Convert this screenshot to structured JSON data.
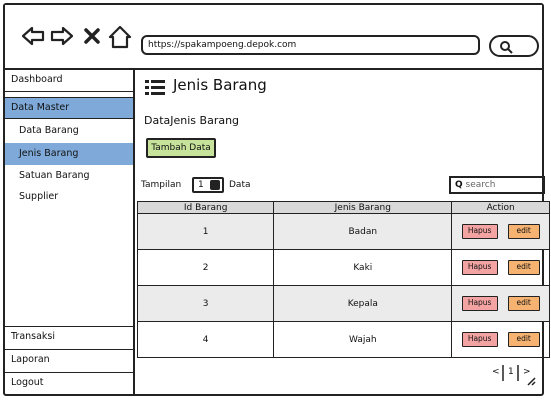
{
  "browser": {
    "url": "https://spakampoeng.depok.com"
  },
  "sidebar": {
    "items": [
      {
        "label": "Dashboard"
      },
      {
        "label": "Data Master"
      },
      {
        "label": "Data Barang"
      },
      {
        "label": "Jenis Barang"
      },
      {
        "label": "Satuan Barang"
      },
      {
        "label": "Supplier"
      },
      {
        "label": "Transaksi"
      },
      {
        "label": "Laporan"
      },
      {
        "label": "Logout"
      }
    ],
    "active": "Data Master",
    "active_sub": "Jenis Barang"
  },
  "main": {
    "title": "Jenis Barang",
    "subtitle": "DataJenis Barang",
    "add_button": "Tambah Data",
    "show_label": "Tampilan",
    "show_value": "1",
    "show_suffix": "Data",
    "search_placeholder": "search",
    "columns": [
      "Id Barang",
      "Jenis Barang",
      "Action"
    ],
    "rows": [
      {
        "id": "1",
        "jenis": "Badan"
      },
      {
        "id": "2",
        "jenis": "Kaki"
      },
      {
        "id": "3",
        "jenis": "Kepala"
      },
      {
        "id": "4",
        "jenis": "Wajah"
      }
    ],
    "actions": {
      "delete": "Hapus",
      "edit": "edit"
    },
    "pager": {
      "prev": "<",
      "page": "1",
      "next": ">"
    }
  },
  "colors": {
    "active_nav": "#7fa9d9",
    "add_button": "#c7e39b",
    "delete_button": "#f4a3a3",
    "edit_button": "#f6b270",
    "table_header": "#d9d9d9"
  },
  "icons": [
    "back-icon",
    "forward-icon",
    "close-icon",
    "home-icon",
    "search-icon",
    "hamburger-icon",
    "stepper-icon",
    "resize-grip-icon"
  ]
}
